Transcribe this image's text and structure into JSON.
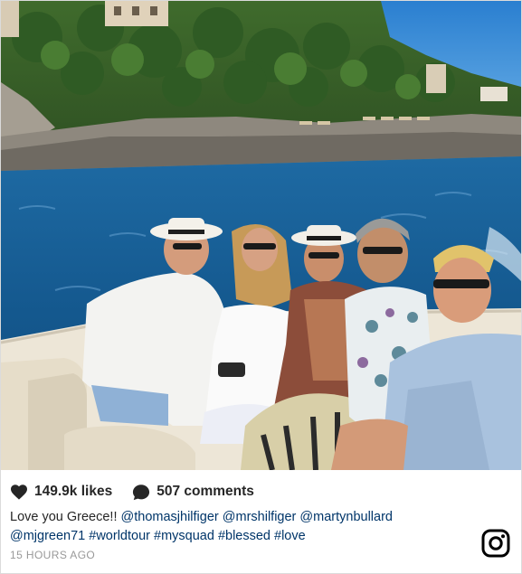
{
  "post": {
    "likes_label": "149.9k likes",
    "comments_label": "507 comments",
    "caption_text": "Love you Greece!!",
    "caption_mentions": [
      "@thomasjhilfiger",
      "@mrshilfiger",
      "@martynbullard",
      "@mjgreen71"
    ],
    "caption_hashtags": [
      "#worldtour",
      "#mysquad",
      "#blessed",
      "#love"
    ],
    "timestamp": "15 HOURS AGO"
  },
  "icons": {
    "like": "heart-icon",
    "comment": "comment-bubble-icon",
    "brand": "instagram-logo-icon"
  },
  "colors": {
    "link": "#003569",
    "text": "#262626",
    "muted": "#999999",
    "sea": "#1f5f93",
    "sky": "#2d83d3"
  }
}
